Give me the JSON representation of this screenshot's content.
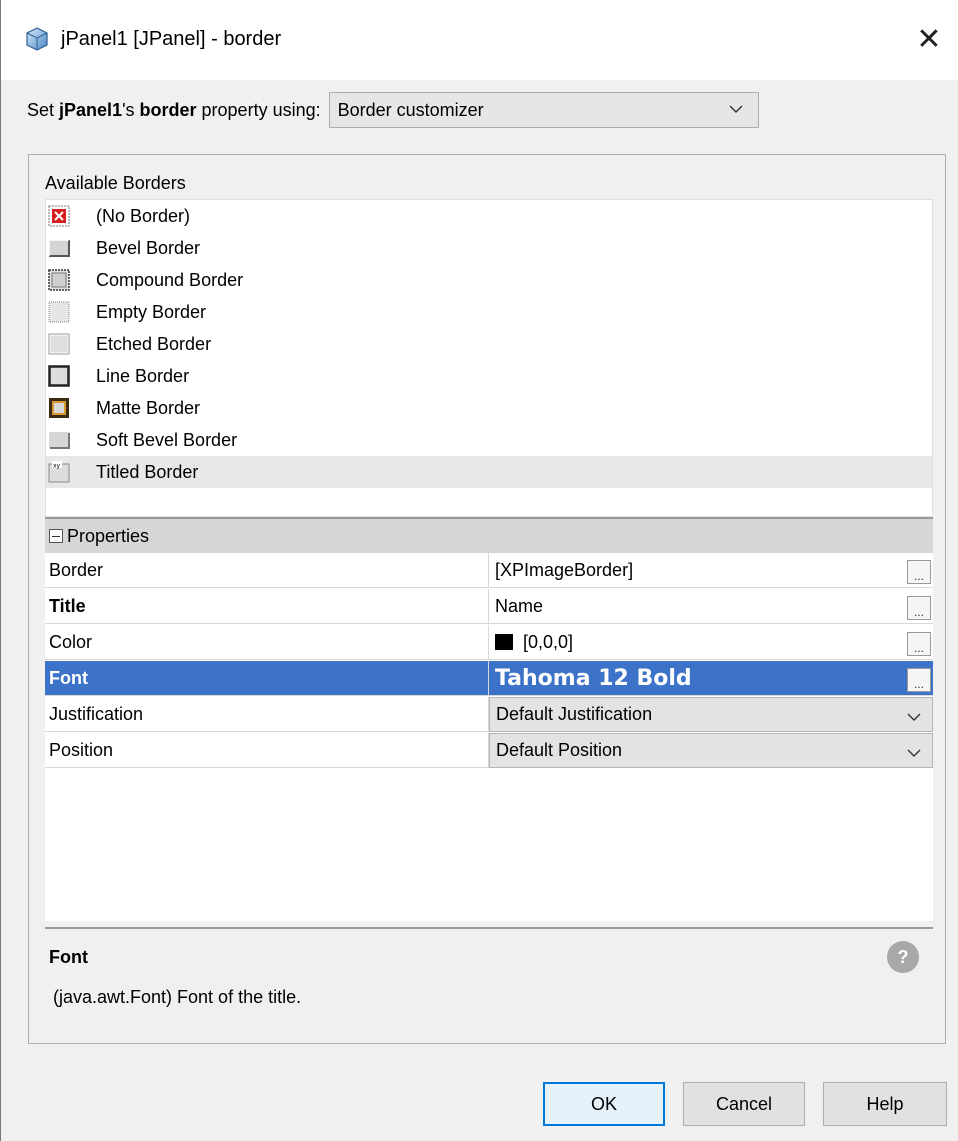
{
  "window": {
    "title": "jPanel1 [JPanel] - border",
    "close_glyph": "✕"
  },
  "setter": {
    "prefix": "Set ",
    "component": "jPanel1",
    "possessive": "'s ",
    "property": "border",
    "suffix": " property using:",
    "mode_value": "Border customizer"
  },
  "available": {
    "label": "Available Borders",
    "items": [
      {
        "label": "(No Border)",
        "icon": "no-border-icon"
      },
      {
        "label": "Bevel Border",
        "icon": "bevel-border-icon"
      },
      {
        "label": "Compound Border",
        "icon": "compound-border-icon"
      },
      {
        "label": "Empty Border",
        "icon": "empty-border-icon"
      },
      {
        "label": "Etched Border",
        "icon": "etched-border-icon"
      },
      {
        "label": "Line Border",
        "icon": "line-border-icon"
      },
      {
        "label": "Matte Border",
        "icon": "matte-border-icon"
      },
      {
        "label": "Soft Bevel Border",
        "icon": "soft-bevel-border-icon"
      },
      {
        "label": "Titled Border",
        "icon": "titled-border-icon",
        "selected": true
      }
    ]
  },
  "properties": {
    "header": "Properties",
    "rows": [
      {
        "name": "Border",
        "value": "[XPImageBorder]",
        "editor": "ellipsis"
      },
      {
        "name": "Title",
        "value": "Name",
        "editor": "ellipsis",
        "bold": true
      },
      {
        "name": "Color",
        "value": "[0,0,0]",
        "editor": "ellipsis",
        "swatch": "#000000"
      },
      {
        "name": "Font",
        "value": "Tahoma 12 Bold",
        "editor": "ellipsis",
        "selected": true
      },
      {
        "name": "Justification",
        "value": "Default Justification",
        "editor": "dropdown"
      },
      {
        "name": "Position",
        "value": "Default Position",
        "editor": "dropdown"
      }
    ],
    "ellipsis_label": "..."
  },
  "description": {
    "title": "Font",
    "text": "(java.awt.Font) Font of the title.",
    "help_glyph": "?"
  },
  "buttons": {
    "ok": "OK",
    "cancel": "Cancel",
    "help": "Help"
  },
  "colors": {
    "selection": "#3c72c8",
    "ok_border": "#0078d7"
  }
}
